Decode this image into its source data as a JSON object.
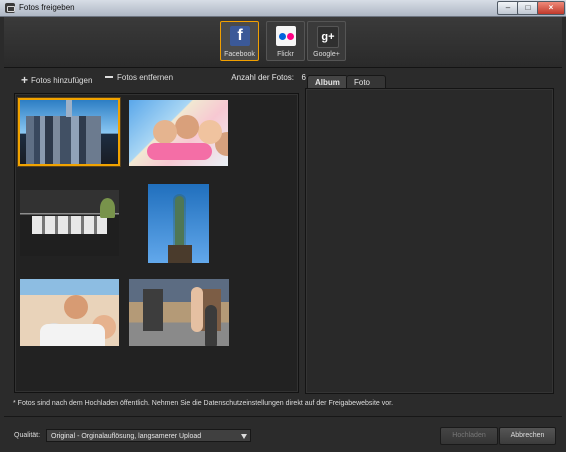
{
  "window": {
    "title": "Fotos freigeben",
    "controls": {
      "min": "–",
      "max": "□",
      "close": "×"
    }
  },
  "services": [
    {
      "label": "Facebook",
      "icon_text": "f",
      "icon": "facebook-icon"
    },
    {
      "label": "Flickr",
      "icon_text": "",
      "icon": "flickr-icon"
    },
    {
      "label": "Google+",
      "icon_text": "g+",
      "icon": "google-plus-icon"
    }
  ],
  "toolbar": {
    "add_label": "Fotos hinzufügen",
    "remove_label": "Fotos entfernen",
    "count_label": "Anzahl der Fotos:",
    "count_value": "6"
  },
  "photos": [
    {
      "name": "city-skyline-photo",
      "description_icon": "city-skyline"
    },
    {
      "name": "friends-photo",
      "description_icon": "friends"
    },
    {
      "name": "restaurant-photo",
      "description_icon": "restaurant"
    },
    {
      "name": "statue-photo",
      "description_icon": "statue"
    },
    {
      "name": "family-photo",
      "description_icon": "family"
    },
    {
      "name": "street-photo",
      "description_icon": "street"
    }
  ],
  "tabs": [
    {
      "label": "Album"
    },
    {
      "label": "Foto"
    }
  ],
  "notice": "* Fotos sind nach dem Hochladen öffentlich. Nehmen Sie die Datenschutzeinstellungen direkt auf der Freigabewebsite vor.",
  "footer": {
    "quality_label": "Qualität:",
    "quality_value": "Original - Orginalauflösung, langsamerer Upload",
    "upload_button": "Hochladen",
    "cancel_button": "Abbrechen"
  },
  "colors": {
    "selection": "#f1a300",
    "facebook": "#3b5998",
    "flickr_blue": "#0063dc",
    "flickr_pink": "#ff0084"
  }
}
